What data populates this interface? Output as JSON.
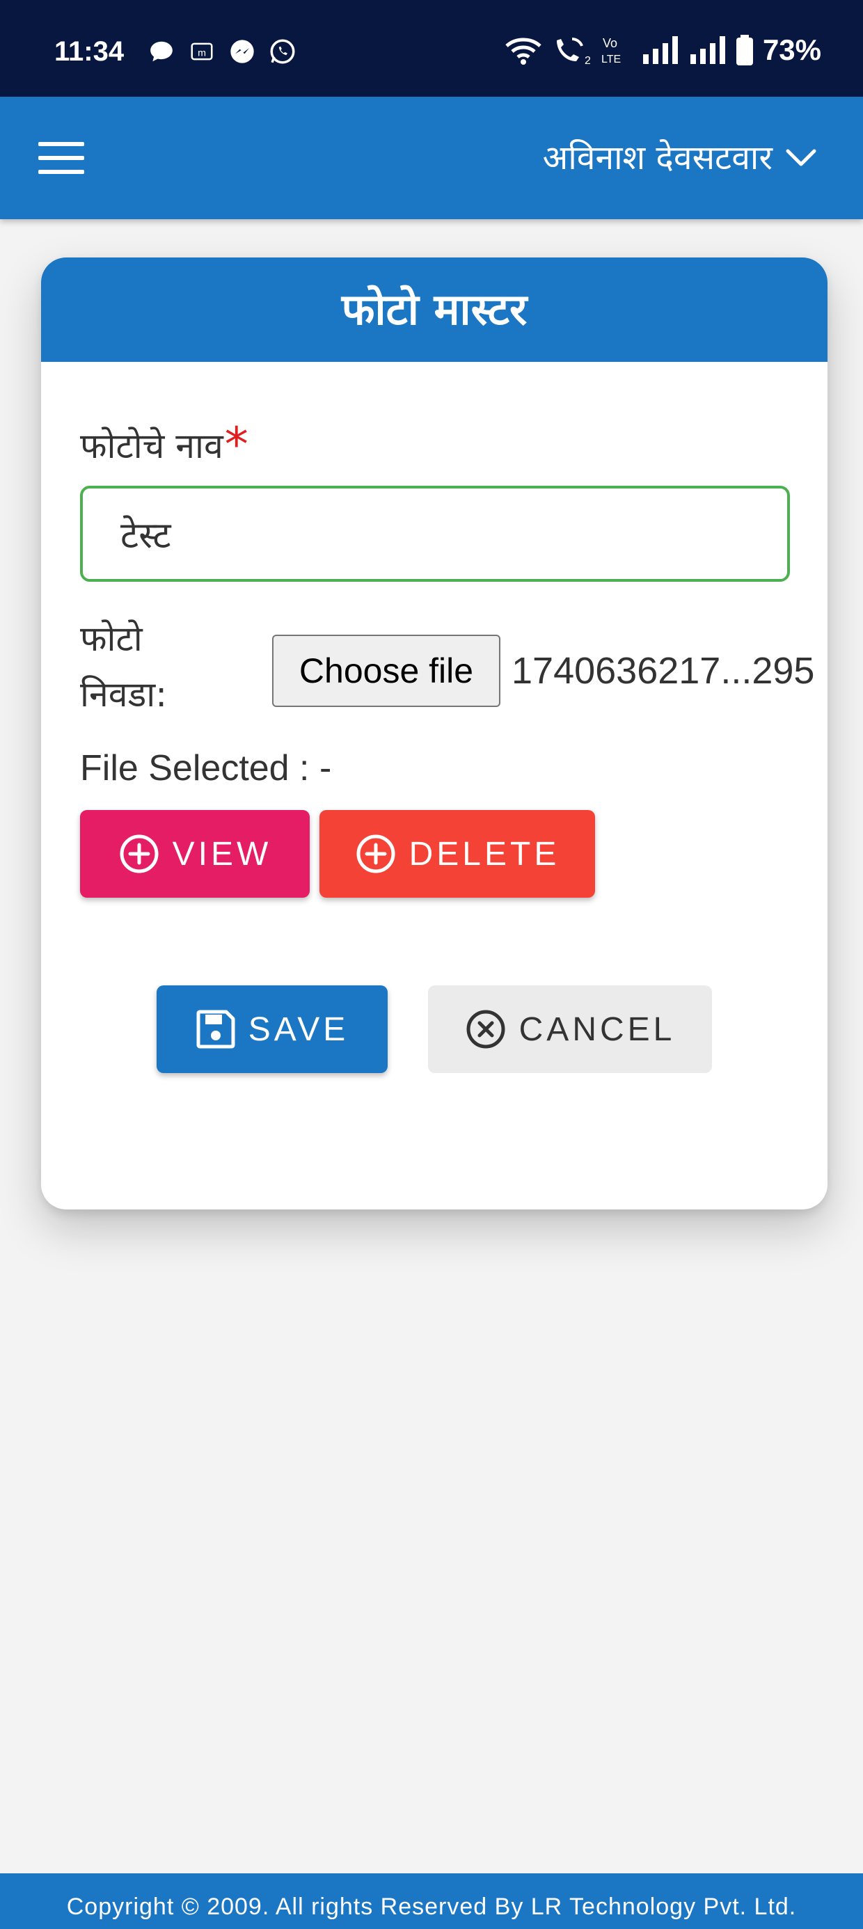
{
  "status_bar": {
    "time": "11:34",
    "battery": "73%",
    "left_icons": [
      "chat-bubble-icon",
      "m-box-icon",
      "messenger-icon",
      "whatsapp-icon"
    ],
    "right_icons": [
      "wifi-icon",
      "wifi-calling-icon",
      "volte-icon",
      "signal-icon",
      "signal-icon",
      "battery-icon"
    ]
  },
  "app_bar": {
    "user_name": "अविनाश देवसटवार",
    "color": "#1b76c4"
  },
  "card": {
    "title": "फोटो मास्टर",
    "name_label": "फोटोचे नाव",
    "required_mark": "*",
    "name_value": "टेस्ट",
    "file_label": "फोटो निवडा:",
    "choose_file_label": "Choose file",
    "file_name": "1740636217...295",
    "file_selected_text": "File Selected : -",
    "view_label": "VIEW",
    "delete_label": "DELETE",
    "save_label": "SAVE",
    "cancel_label": "CANCEL"
  },
  "colors": {
    "primary": "#1b76c4",
    "view": "#e41d65",
    "delete": "#f44336",
    "input_border": "#4caf50",
    "status_bar": "#08173f"
  },
  "footer": {
    "text": "Copyright © 2009. All rights Reserved By LR Technology Pvt. Ltd."
  }
}
